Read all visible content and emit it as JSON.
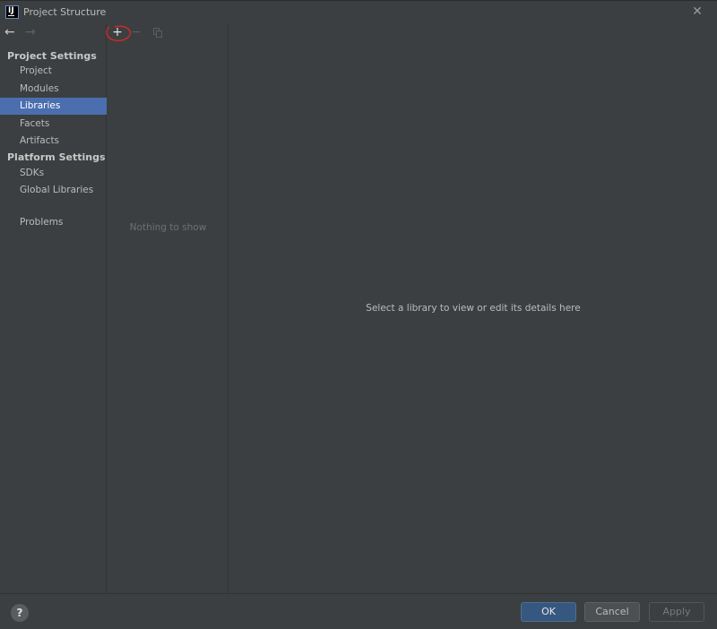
{
  "window": {
    "title": "Project Structure",
    "close_icon": "close-icon"
  },
  "navigation": {
    "back_icon": "←",
    "forward_icon": "→"
  },
  "sidebar": {
    "project_settings_header": "Project Settings",
    "project_settings_items": [
      {
        "label": "Project",
        "selected": false
      },
      {
        "label": "Modules",
        "selected": false
      },
      {
        "label": "Libraries",
        "selected": true
      },
      {
        "label": "Facets",
        "selected": false
      },
      {
        "label": "Artifacts",
        "selected": false
      }
    ],
    "platform_settings_header": "Platform Settings",
    "platform_settings_items": [
      {
        "label": "SDKs",
        "selected": false
      },
      {
        "label": "Global Libraries",
        "selected": false
      }
    ],
    "problems_label": "Problems"
  },
  "list_panel": {
    "toolbar": {
      "add_glyph": "+",
      "remove_glyph": "−"
    },
    "empty_text": "Nothing to show"
  },
  "details_panel": {
    "placeholder_text": "Select a library to view or edit its details here"
  },
  "footer": {
    "help_glyph": "?",
    "ok_label": "OK",
    "cancel_label": "Cancel",
    "apply_label": "Apply"
  },
  "colors": {
    "background": "#3c3f41",
    "selection": "#4b6eaf",
    "ok_button": "#365880",
    "annotation": "#d62828"
  }
}
